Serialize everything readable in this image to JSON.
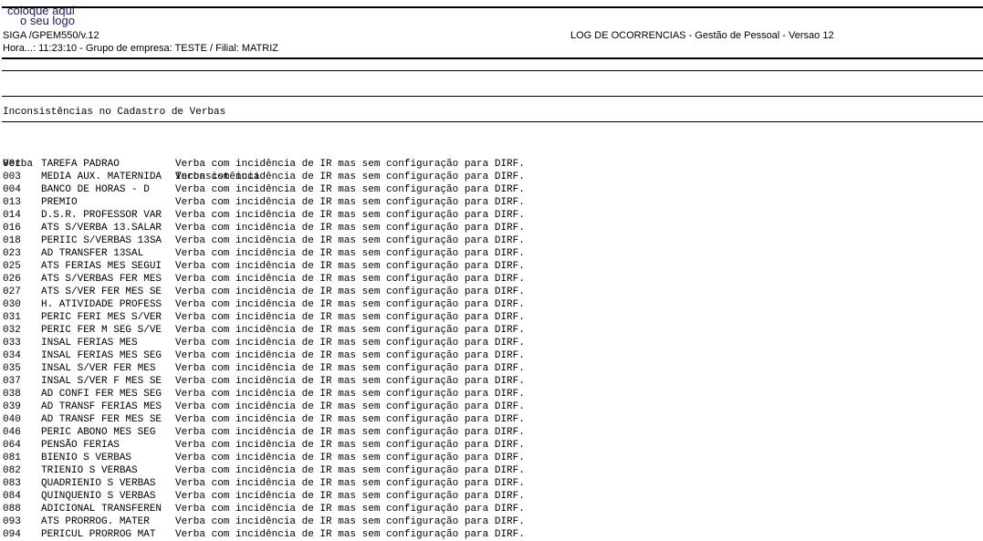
{
  "logo": {
    "line1": "coloque aqui",
    "line2": "o seu logo"
  },
  "header": {
    "program": "SIGA /GPEM550/v.12",
    "title": "LOG DE OCORRENCIAS - Gestão de Pessoal - Versao 12",
    "info": "Hora...: 11:23:10 - Grupo de empresa: TESTE / Filial: MATRIZ"
  },
  "section_title": "Inconsistências no Cadastro de Verbas",
  "table": {
    "headers": {
      "verba": "Verba",
      "inconsistencia": "Inconsistência"
    },
    "rows": [
      {
        "code": "001",
        "name": "TAREFA PADRAO",
        "msg": "Verba com incidência de IR mas sem configuração para DIRF."
      },
      {
        "code": "003",
        "name": "MEDIA AUX. MATERNIDA",
        "msg": "Verba com incidência de IR mas sem configuração para DIRF."
      },
      {
        "code": "004",
        "name": "BANCO DE HORAS - D",
        "msg": "Verba com incidência de IR mas sem configuração para DIRF."
      },
      {
        "code": "013",
        "name": "PREMIO",
        "msg": "Verba com incidência de IR mas sem configuração para DIRF."
      },
      {
        "code": "014",
        "name": "D.S.R. PROFESSOR VAR",
        "msg": "Verba com incidência de IR mas sem configuração para DIRF."
      },
      {
        "code": "016",
        "name": "ATS S/VERBA 13.SALAR",
        "msg": "Verba com incidência de IR mas sem configuração para DIRF."
      },
      {
        "code": "018",
        "name": "PERIIC S/VERBAS 13SA",
        "msg": "Verba com incidência de IR mas sem configuração para DIRF."
      },
      {
        "code": "023",
        "name": "AD TRANSFER 13SAL",
        "msg": "Verba com incidência de IR mas sem configuração para DIRF."
      },
      {
        "code": "025",
        "name": "ATS FERIAS MES SEGUI",
        "msg": "Verba com incidência de IR mas sem configuração para DIRF."
      },
      {
        "code": "026",
        "name": "ATS S/VERBAS FER MES",
        "msg": "Verba com incidência de IR mas sem configuração para DIRF."
      },
      {
        "code": "027",
        "name": "ATS S/VER FER MES SE",
        "msg": "Verba com incidência de IR mas sem configuração para DIRF."
      },
      {
        "code": "030",
        "name": "H. ATIVIDADE PROFESS",
        "msg": "Verba com incidência de IR mas sem configuração para DIRF."
      },
      {
        "code": "031",
        "name": "PERIC FERI MES S/VER",
        "msg": "Verba com incidência de IR mas sem configuração para DIRF."
      },
      {
        "code": "032",
        "name": "PERIC FER M SEG S/VE",
        "msg": "Verba com incidência de IR mas sem configuração para DIRF."
      },
      {
        "code": "033",
        "name": "INSAL FERIAS MES",
        "msg": "Verba com incidência de IR mas sem configuração para DIRF."
      },
      {
        "code": "034",
        "name": "INSAL FERIAS MES SEG",
        "msg": "Verba com incidência de IR mas sem configuração para DIRF."
      },
      {
        "code": "035",
        "name": "INSAL S/VER FER MES",
        "msg": "Verba com incidência de IR mas sem configuração para DIRF."
      },
      {
        "code": "037",
        "name": "INSAL S/VER F MES SE",
        "msg": "Verba com incidência de IR mas sem configuração para DIRF."
      },
      {
        "code": "038",
        "name": "AD CONFI FER MES SEG",
        "msg": "Verba com incidência de IR mas sem configuração para DIRF."
      },
      {
        "code": "039",
        "name": "AD TRANSF FERIAS MES",
        "msg": "Verba com incidência de IR mas sem configuração para DIRF."
      },
      {
        "code": "040",
        "name": "AD TRANSF FER MES SE",
        "msg": "Verba com incidência de IR mas sem configuração para DIRF."
      },
      {
        "code": "046",
        "name": "PERIC ABONO MES SEG",
        "msg": "Verba com incidência de IR mas sem configuração para DIRF."
      },
      {
        "code": "064",
        "name": "PENSÃO FERIAS",
        "msg": "Verba com incidência de IR mas sem configuração para DIRF."
      },
      {
        "code": "081",
        "name": "BIENIO S VERBAS",
        "msg": "Verba com incidência de IR mas sem configuração para DIRF."
      },
      {
        "code": "082",
        "name": "TRIENIO S VERBAS",
        "msg": "Verba com incidência de IR mas sem configuração para DIRF."
      },
      {
        "code": "083",
        "name": "QUADRIENIO S VERBAS",
        "msg": "Verba com incidência de IR mas sem configuração para DIRF."
      },
      {
        "code": "084",
        "name": "QUINQUENIO S VERBAS",
        "msg": "Verba com incidência de IR mas sem configuração para DIRF."
      },
      {
        "code": "088",
        "name": "ADICIONAL TRANSFEREN",
        "msg": "Verba com incidência de IR mas sem configuração para DIRF."
      },
      {
        "code": "093",
        "name": "ATS PRORROG. MATER",
        "msg": "Verba com incidência de IR mas sem configuração para DIRF."
      },
      {
        "code": "094",
        "name": "PERICUL PRORROG MAT",
        "msg": "Verba com incidência de IR mas sem configuração para DIRF."
      }
    ]
  }
}
